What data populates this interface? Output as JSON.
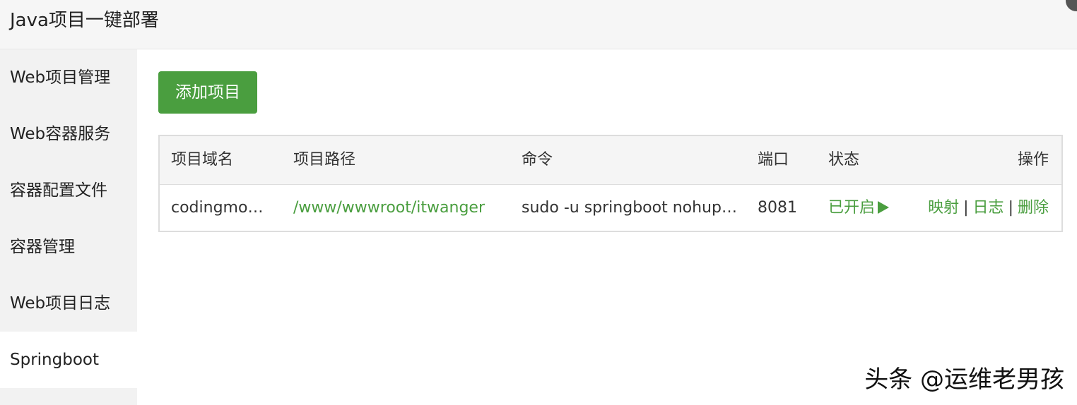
{
  "window": {
    "title": "Java项目一键部署"
  },
  "sidebar": {
    "items": [
      {
        "label": "Web项目管理",
        "active": false
      },
      {
        "label": "Web容器服务",
        "active": false
      },
      {
        "label": "容器配置文件",
        "active": false
      },
      {
        "label": "容器管理",
        "active": false
      },
      {
        "label": "Web项目日志",
        "active": false
      },
      {
        "label": "Springboot",
        "active": true
      }
    ]
  },
  "main": {
    "add_button_label": "添加项目",
    "table": {
      "headers": [
        "项目域名",
        "项目路径",
        "命令",
        "端口",
        "状态",
        "操作"
      ],
      "rows": [
        {
          "domain": "codingmor…",
          "path": "/www/wwwroot/itwanger",
          "command": "sudo -u springboot nohup…",
          "port": "8081",
          "status": "已开启",
          "status_icon": "play-icon",
          "actions": [
            "映射",
            "日志",
            "删除"
          ],
          "separator": "|"
        }
      ]
    }
  },
  "watermark": "头条 @运维老男孩",
  "colors": {
    "accent_green": "#4a9e3f",
    "sidebar_bg": "#f2f2f2",
    "header_bg": "#f5f5f5"
  }
}
